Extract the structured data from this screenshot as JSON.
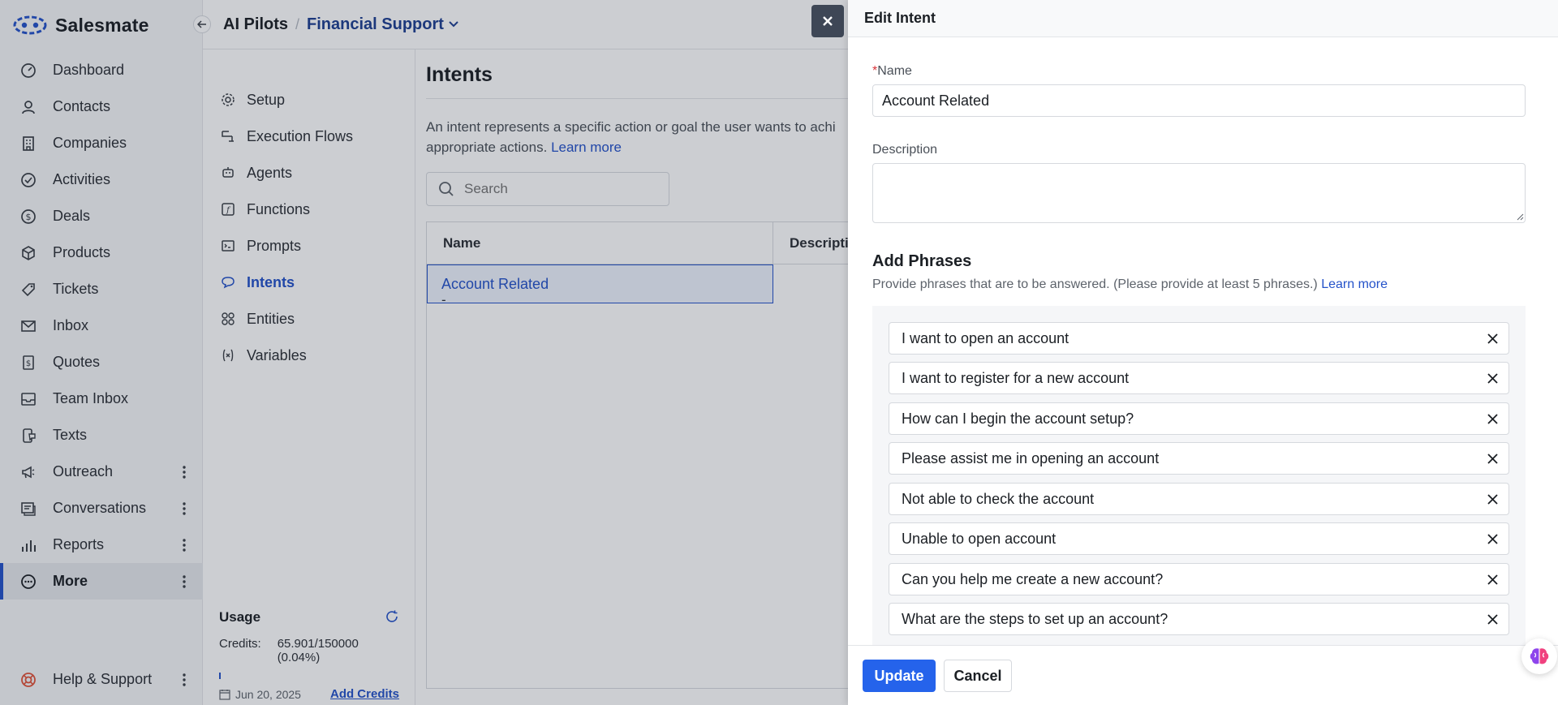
{
  "brand": {
    "name": "Salesmate"
  },
  "nav": {
    "items": [
      {
        "label": "Dashboard",
        "icon": "dashboard-icon"
      },
      {
        "label": "Contacts",
        "icon": "contacts-icon"
      },
      {
        "label": "Companies",
        "icon": "companies-icon"
      },
      {
        "label": "Activities",
        "icon": "activities-icon"
      },
      {
        "label": "Deals",
        "icon": "deals-icon"
      },
      {
        "label": "Products",
        "icon": "products-icon"
      },
      {
        "label": "Tickets",
        "icon": "tickets-icon"
      },
      {
        "label": "Inbox",
        "icon": "inbox-icon"
      },
      {
        "label": "Quotes",
        "icon": "quotes-icon"
      },
      {
        "label": "Team Inbox",
        "icon": "team-inbox-icon"
      },
      {
        "label": "Texts",
        "icon": "texts-icon"
      },
      {
        "label": "Outreach",
        "icon": "outreach-icon"
      },
      {
        "label": "Conversations",
        "icon": "conversations-icon"
      },
      {
        "label": "Reports",
        "icon": "reports-icon"
      },
      {
        "label": "More",
        "icon": "more-icon"
      }
    ],
    "help": {
      "label": "Help & Support",
      "icon": "help-icon"
    }
  },
  "breadcrumb": {
    "root": "AI Pilots",
    "separator": "/",
    "current": "Financial Support"
  },
  "subnav": {
    "items": [
      {
        "label": "Setup",
        "icon": "gear-icon"
      },
      {
        "label": "Execution Flows",
        "icon": "flow-icon"
      },
      {
        "label": "Agents",
        "icon": "agent-icon"
      },
      {
        "label": "Functions",
        "icon": "function-icon"
      },
      {
        "label": "Prompts",
        "icon": "prompt-icon"
      },
      {
        "label": "Intents",
        "icon": "intent-icon"
      },
      {
        "label": "Entities",
        "icon": "entity-icon"
      },
      {
        "label": "Variables",
        "icon": "variable-icon"
      }
    ],
    "active": "Intents"
  },
  "usage": {
    "title": "Usage",
    "credits_label": "Credits:",
    "credits_value": "65.901/150000 (0.04%)",
    "progress_fraction": 0.0004,
    "date": "Jun 20, 2025",
    "add_credits": "Add Credits"
  },
  "content": {
    "title": "Intents",
    "description": "An intent represents a specific action or goal the user wants to achi",
    "description_line2": "appropriate actions.",
    "learn_more": "Learn more",
    "search_placeholder": "Search",
    "table": {
      "columns": [
        "Name",
        "Descriptio"
      ],
      "rows": [
        {
          "name": "Account Related",
          "description": "-"
        }
      ]
    }
  },
  "drawer": {
    "title": "Edit Intent",
    "name_required_mark": "*",
    "name_label": "Name",
    "name_value": "Account Related",
    "description_label": "Description",
    "description_value": "",
    "phrases_title": "Add Phrases",
    "phrases_subtitle": "Provide phrases that are to be answered. (Please provide at least 5 phrases.)",
    "phrases_learn_more": "Learn more",
    "phrases": [
      "I want to open an account",
      "I want to register for a new account",
      "How can I begin the account setup?",
      "Please assist me in opening an account",
      "Not able to check the account",
      "Unable to open account",
      "Can you help me create a new account?",
      "What are the steps to set up an account?"
    ],
    "update_label": "Update",
    "cancel_label": "Cancel"
  },
  "colors": {
    "accent": "#2452c9",
    "primary_button": "#2563eb",
    "breadcrumb_current": "#1e3f91",
    "selected_row_bg": "#eef3fd"
  }
}
